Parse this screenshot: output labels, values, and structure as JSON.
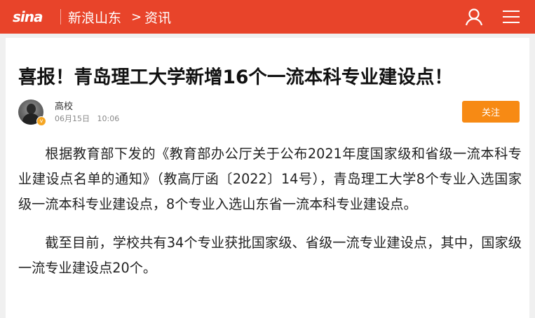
{
  "header": {
    "logo_text": "sina",
    "channel": "新浪山东",
    "crumb_separator": ">",
    "subchannel": "资讯",
    "brand_color": "#e8442a"
  },
  "article": {
    "title": "喜报！青岛理工大学新增16个一流本科专业建设点！",
    "author": {
      "name": "高校",
      "date": "06月15日",
      "time": "10:06",
      "verified_badge": "v"
    },
    "follow_label": "关注",
    "follow_color": "#f78a14",
    "paragraphs": [
      "根据教育部下发的《教育部办公厅关于公布2021年度国家级和省级一流本科专业建设点名单的通知》（教高厅函〔2022〕14号），青岛理工大学8个专业入选国家级一流本科专业建设点，8个专业入选山东省一流本科专业建设点。",
      "截至目前，学校共有34个专业获批国家级、省级一流专业建设点，其中，国家级一流专业建设点20个。"
    ]
  },
  "icons": {
    "user": "user-icon",
    "menu": "menu-icon",
    "verified": "verified-icon"
  }
}
